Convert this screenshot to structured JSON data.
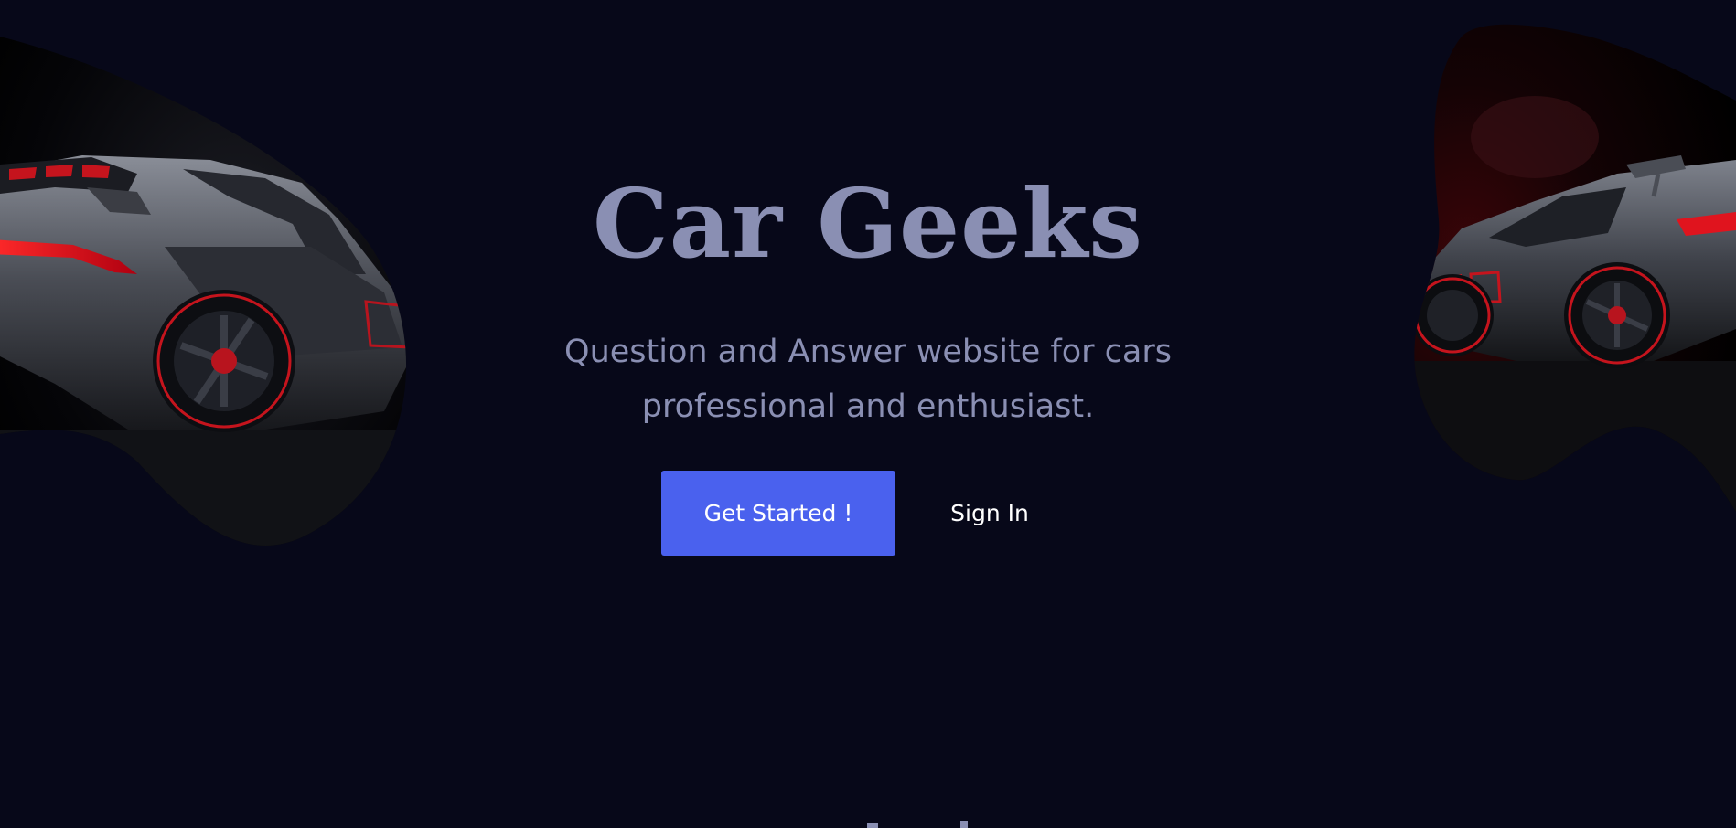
{
  "hero": {
    "title": "Car Geeks",
    "subtitle": "Question and Answer website for cars professional and enthusiast.",
    "primary_button": "Get Started !",
    "secondary_button": "Sign In"
  },
  "images": {
    "left": "sports-car-rear-image",
    "right": "sports-car-side-image"
  },
  "colors": {
    "background": "#070819",
    "heading": "#8a8fb3",
    "accent": "#4a61ee",
    "car_glow": "#e0141e"
  }
}
